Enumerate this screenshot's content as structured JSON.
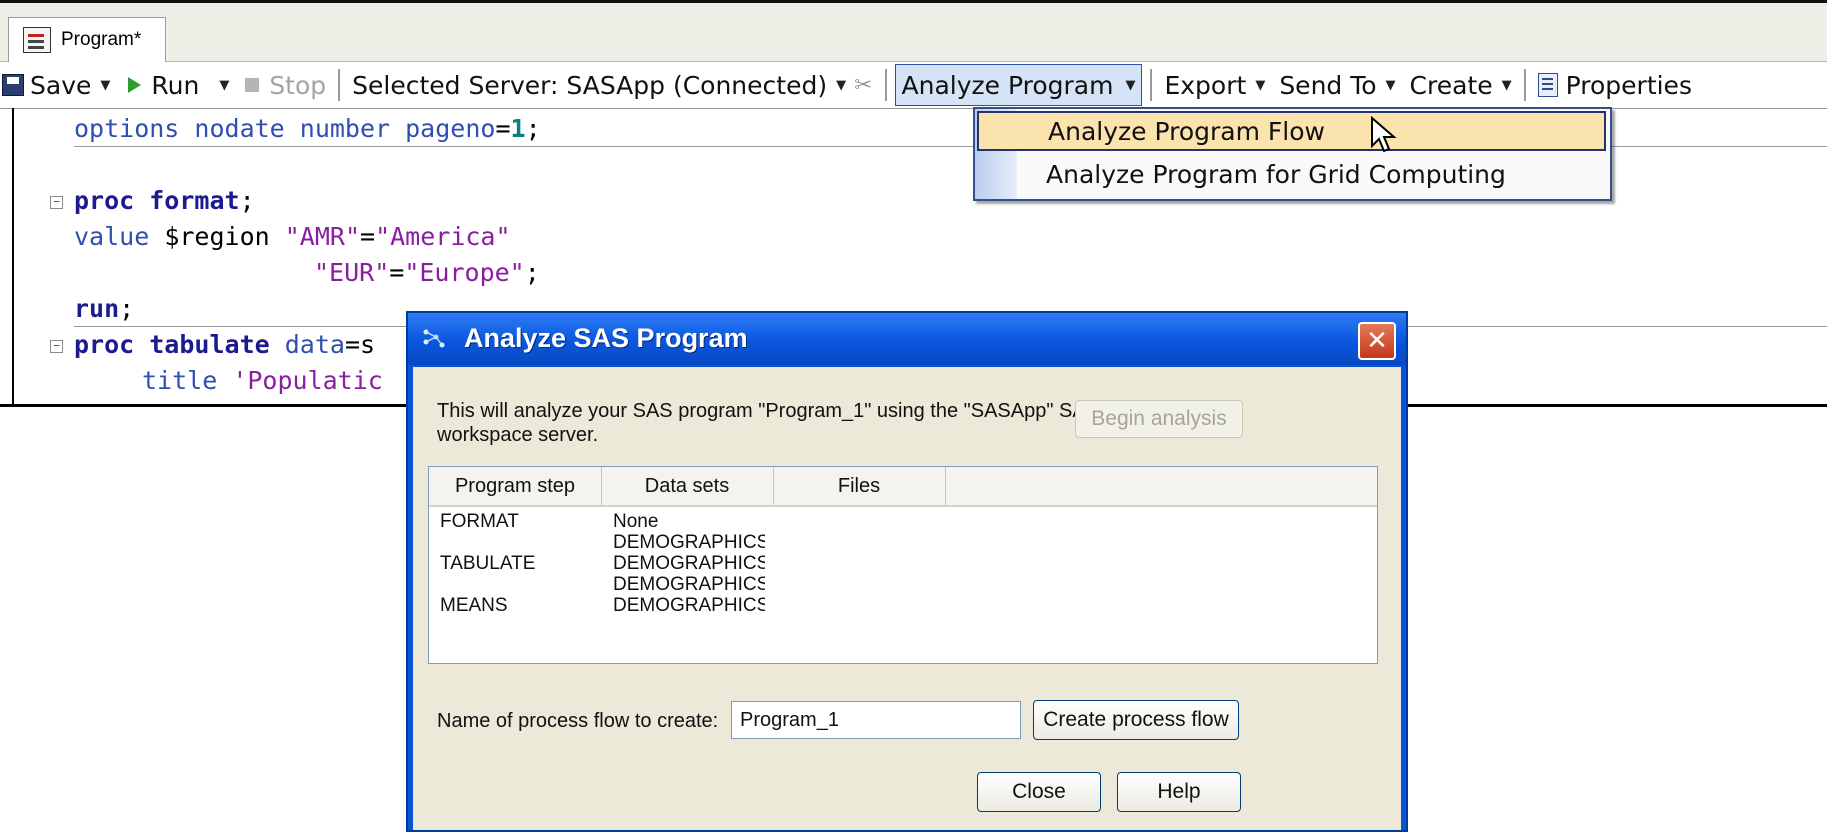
{
  "tab": {
    "label": "Program*"
  },
  "toolbar": {
    "save": "Save",
    "run": "Run",
    "stop": "Stop",
    "server": "Selected Server: SASApp (Connected)",
    "analyze": "Analyze Program",
    "export": "Export",
    "send_to": "Send To",
    "create": "Create",
    "properties": "Properties"
  },
  "code": {
    "l1_kw": "options nodate number pageno",
    "l1_eq": "=",
    "l1_num": "1",
    "l1_end": ";",
    "l2_kw": "proc format",
    "l2_end": ";",
    "l3_kw": "value",
    "l3_var": " $region ",
    "l3_s1": "\"AMR\"",
    "l3_eq": "=",
    "l3_s2": "\"America\"",
    "l4_s1": "\"EUR\"",
    "l4_eq": "=",
    "l4_s2": "\"Europe\"",
    "l4_end": ";",
    "l5_kw": "run",
    "l5_end": ";",
    "l6_kw": "proc tabulate",
    "l6_opt": " data",
    "l6_eq": "=s",
    "l7_kw": "title",
    "l7_str": " 'Populatic"
  },
  "menu": {
    "items": [
      "Analyze Program Flow",
      "Analyze Program for Grid Computing"
    ]
  },
  "dialog": {
    "title": "Analyze SAS Program",
    "description": "This will analyze your SAS program \"Program_1\" using the \"SASApp\" SAS workspace server.",
    "begin_button": "Begin analysis",
    "columns": [
      "Program step",
      "Data sets",
      "Files"
    ],
    "rows": [
      {
        "step": "FORMAT",
        "data": "None"
      },
      {
        "step": "",
        "data": "DEMOGRAPHICS"
      },
      {
        "step": "TABULATE",
        "data": "DEMOGRAPHICS"
      },
      {
        "step": "",
        "data": "DEMOGRAPHICS"
      },
      {
        "step": "MEANS",
        "data": "DEMOGRAPHICS"
      }
    ],
    "flow_label": "Name of process flow to create:",
    "flow_name": "Program_1",
    "create_button": "Create process flow",
    "close_button": "Close",
    "help_button": "Help"
  }
}
